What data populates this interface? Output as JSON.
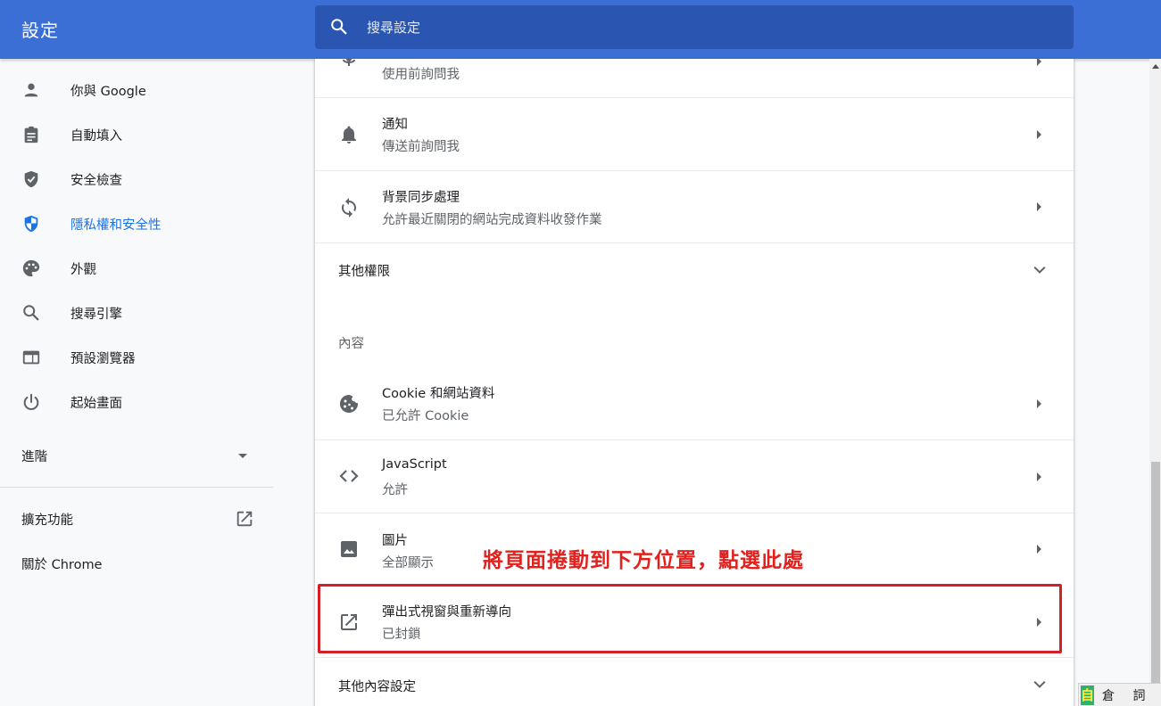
{
  "header": {
    "title": "設定",
    "search_placeholder": "搜尋設定"
  },
  "sidebar": {
    "items": [
      {
        "label": "你與 Google",
        "icon": "person-icon"
      },
      {
        "label": "自動填入",
        "icon": "clipboard-icon"
      },
      {
        "label": "安全檢查",
        "icon": "shield-check-icon"
      },
      {
        "label": "隱私權和安全性",
        "icon": "privacy-shield-icon",
        "active": true
      },
      {
        "label": "外觀",
        "icon": "palette-icon"
      },
      {
        "label": "搜尋引擎",
        "icon": "search-icon"
      },
      {
        "label": "預設瀏覽器",
        "icon": "browser-icon"
      },
      {
        "label": "起始畫面",
        "icon": "power-icon"
      }
    ],
    "advanced_label": "進階",
    "extensions_label": "擴充功能",
    "about_label": "關於 Chrome"
  },
  "main": {
    "rows": [
      {
        "title": "",
        "subtitle": "使用前詢問我",
        "icon": "microphone-icon"
      },
      {
        "title": "通知",
        "subtitle": "傳送前詢問我",
        "icon": "bell-icon"
      },
      {
        "title": "背景同步處理",
        "subtitle": "允許最近關閉的網站完成資料收發作業",
        "icon": "sync-icon"
      }
    ],
    "other_permissions_label": "其他權限",
    "content_section_label": "內容",
    "content_rows": [
      {
        "title": "Cookie 和網站資料",
        "subtitle": "已允許 Cookie",
        "icon": "cookie-icon"
      },
      {
        "title": "JavaScript",
        "subtitle": "允許",
        "icon": "code-icon"
      },
      {
        "title": "圖片",
        "subtitle": "全部顯示",
        "icon": "image-icon"
      },
      {
        "title": "彈出式視窗與重新導向",
        "subtitle": "已封鎖",
        "icon": "open-in-new-icon"
      }
    ],
    "other_content_settings_label": "其他內容設定"
  },
  "annotation": {
    "text": "將頁面捲動到下方位置，點選此處",
    "color": "#e0211d"
  },
  "ime": {
    "mode": "自",
    "text": "倉 詞 ’,"
  },
  "colors": {
    "header_bg": "#3b6fd6",
    "search_bg": "#2a55b0",
    "active_nav": "#1a73e8"
  }
}
